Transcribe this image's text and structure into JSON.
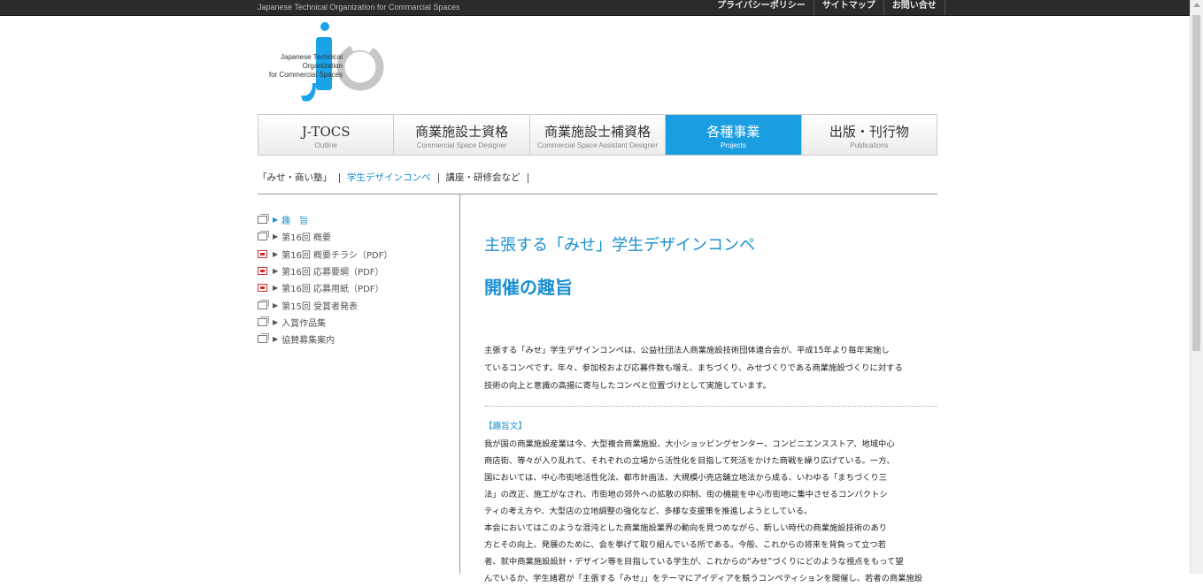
{
  "topbar": {
    "tagline": "Japanese Technical Organization for Commarcial Spaces",
    "links": [
      "プライバシーポリシー",
      "サイトマップ",
      "お問い合せ"
    ]
  },
  "logo": {
    "lines": [
      "Japanese Technical",
      "Organization",
      "for Commercial Spaces"
    ],
    "wordmark": "J-TOCS"
  },
  "mainnav": [
    {
      "jp": "J-TOCS",
      "en": "Outline",
      "active": false
    },
    {
      "jp": "商業施設士資格",
      "en": "Commercial Space Designer",
      "active": false
    },
    {
      "jp": "商業施設士補資格",
      "en": "Commercial Space Assistant Designer",
      "active": false
    },
    {
      "jp": "各種事業",
      "en": "Projects",
      "active": true
    },
    {
      "jp": "出版・刊行物",
      "en": "Publications",
      "active": false
    }
  ],
  "subnav": [
    "「みせ・商い塾」",
    "学生デザインコンペ",
    "講座・研修会など"
  ],
  "sidebar": [
    {
      "label": "趣　旨",
      "icon": "page-icon",
      "current": true
    },
    {
      "label": "第16回 概要",
      "icon": "page-icon",
      "current": false
    },
    {
      "label": "第16回 概要チラシ（PDF）",
      "icon": "pdf-icon",
      "current": false
    },
    {
      "label": "第16回 応募要綱（PDF）",
      "icon": "pdf-icon",
      "current": false
    },
    {
      "label": "第16回 応募用紙（PDF）",
      "icon": "pdf-icon",
      "current": false
    },
    {
      "label": "第15回 受賞者発表",
      "icon": "page-icon",
      "current": false
    },
    {
      "label": "入賞作品集",
      "icon": "page-icon",
      "current": false
    },
    {
      "label": "協賛募集案内",
      "icon": "page-icon",
      "current": false
    }
  ],
  "content": {
    "subtitle": "主張する「みせ」学生デザインコンペ",
    "title": "開催の趣旨",
    "lead": [
      "主張する「みせ」学生デザインコンペは、公益社団法人商業施設技術団体連合会が、平成15年より毎年実施し",
      "ているコンペです。年々、参加校および応募件数も増え、まちづくり、みせづくりである商業施設づくりに対する",
      "技術の向上と意識の高揚に寄与したコンペと位置づけとして実施しています。"
    ],
    "section_label": "【趣旨文】",
    "body": [
      "我が国の商業施設産業は今、大型複合商業施設、大小ショッピングセンター、コンビニエンスストア、地域中心",
      "商店街、等々が入り乱れて、それぞれの立場から活性化を目指して死活をかけた商戦を繰り広げている。一方、",
      "国においては、中心市街地活性化法、都市計画法、大規模小売店舗立地法から成る、いわゆる「まちづくり三",
      "法」の改正、施工がなされ、市街地の郊外への拡散の抑制、街の機能を中心市街地に集中させるコンパクトシ",
      "ティの考え方や、大型店の立地調整の強化など、多様な支援策を推進しようとしている。",
      "本会においてはこのような混沌とした商業施設業界の動向を見つめながら、新しい時代の商業施設技術のあり",
      "方とその向上、発展のために、会を挙げて取り組んでいる所である。今般、これからの将来を背負って立つ若",
      "者、就中商業施設設計・デザイン等を目指している学生が、これからの“みせ”づくりにどのような視点をもって望",
      "んでいるか、学生諸君が「主張する「みせ」」をテーマにアイディアを競うコンペティションを開催し、若者の商業施設"
    ]
  },
  "colors": {
    "accent": "#1a9ee1",
    "topbar": "#2b2b2b",
    "text": "#222222"
  }
}
